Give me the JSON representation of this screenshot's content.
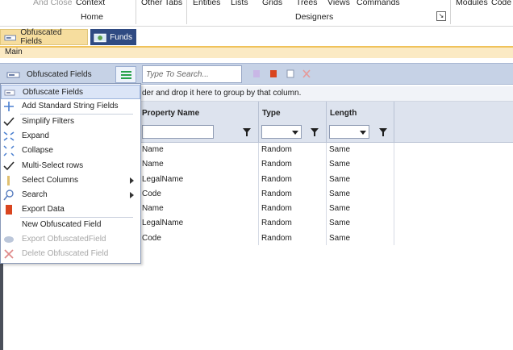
{
  "ribbon": {
    "top_labels": [
      "And Close",
      "Context",
      "Other Tabs",
      "Entities",
      "Lists",
      "Grids",
      "Trees",
      "Views",
      "Commands",
      "Modules",
      "Code"
    ],
    "groups": [
      "Home",
      "Designers"
    ]
  },
  "doc_tabs": [
    "Obfuscated Fields",
    "Funds"
  ],
  "main_label": "Main",
  "toolbar": {
    "title": "Obfuscated Fields",
    "search_placeholder": "Type To Search..."
  },
  "group_hint": "der and drop it here to group by that column.",
  "grid": {
    "columns": [
      "Property Name",
      "Type",
      "Length"
    ],
    "rows": [
      [
        "Name",
        "Random",
        "Same"
      ],
      [
        "Name",
        "Random",
        "Same"
      ],
      [
        "LegalName",
        "Random",
        "Same"
      ],
      [
        "Code",
        "Random",
        "Same"
      ],
      [
        "Name",
        "Random",
        "Same"
      ],
      [
        "LegalName",
        "Random",
        "Same"
      ],
      [
        "Code",
        "Random",
        "Same"
      ]
    ]
  },
  "context_menu": {
    "items": [
      {
        "label": "Obfuscate Fields",
        "icon": "fields-icon",
        "state": "hover"
      },
      {
        "label": "Add Standard String Fields",
        "icon": "plus-icon",
        "state": "normal"
      },
      {
        "label": "Simplify Filters",
        "icon": "check-icon",
        "state": "normal"
      },
      {
        "label": "Expand",
        "icon": "expand-icon",
        "state": "normal"
      },
      {
        "label": "Collapse",
        "icon": "collapse-icon",
        "state": "normal"
      },
      {
        "label": "Multi-Select rows",
        "icon": "check-icon",
        "state": "normal"
      },
      {
        "label": "Select Columns",
        "icon": "columns-icon",
        "state": "submenu"
      },
      {
        "label": "Search",
        "icon": "search-icon",
        "state": "submenu"
      },
      {
        "label": "Export Data",
        "icon": "office-icon",
        "state": "normal"
      },
      {
        "label": "New Obfuscated Field",
        "icon": "",
        "state": "normal"
      },
      {
        "label": "Export ObfuscatedField",
        "icon": "cloud-export-icon",
        "state": "disabled"
      },
      {
        "label": "Delete Obfuscated Field",
        "icon": "delete-icon",
        "state": "disabled"
      }
    ]
  },
  "colors": {
    "accent": "#2f4a82",
    "toolbar": "#c6d2e6",
    "tab_active": "#f6dd9e"
  }
}
